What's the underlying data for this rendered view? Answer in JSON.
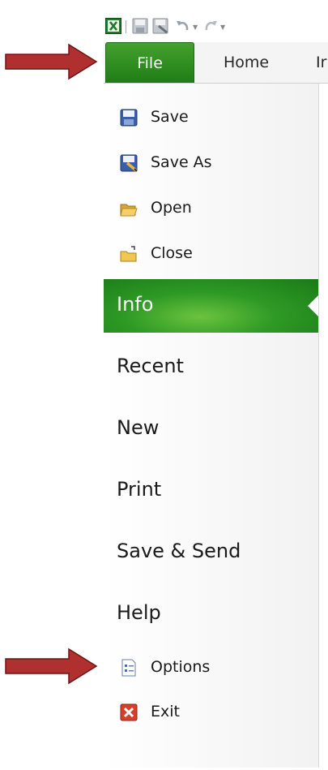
{
  "tabs": {
    "file": "File",
    "home": "Home",
    "partial": "Ir"
  },
  "menu_small_top": [
    {
      "label": "Save",
      "icon": "save-icon"
    },
    {
      "label": "Save As",
      "icon": "save-as-icon"
    },
    {
      "label": "Open",
      "icon": "open-folder-icon"
    },
    {
      "label": "Close",
      "icon": "close-folder-icon"
    }
  ],
  "menu_big": [
    {
      "label": "Info",
      "selected": true
    },
    {
      "label": "Recent"
    },
    {
      "label": "New"
    },
    {
      "label": "Print"
    },
    {
      "label": "Save & Send"
    },
    {
      "label": "Help"
    }
  ],
  "menu_small_bottom": [
    {
      "label": "Options",
      "icon": "options-icon"
    },
    {
      "label": "Exit",
      "icon": "exit-icon"
    }
  ],
  "colors": {
    "accent_green": "#2e9a25",
    "arrow_red": "#b03030"
  }
}
